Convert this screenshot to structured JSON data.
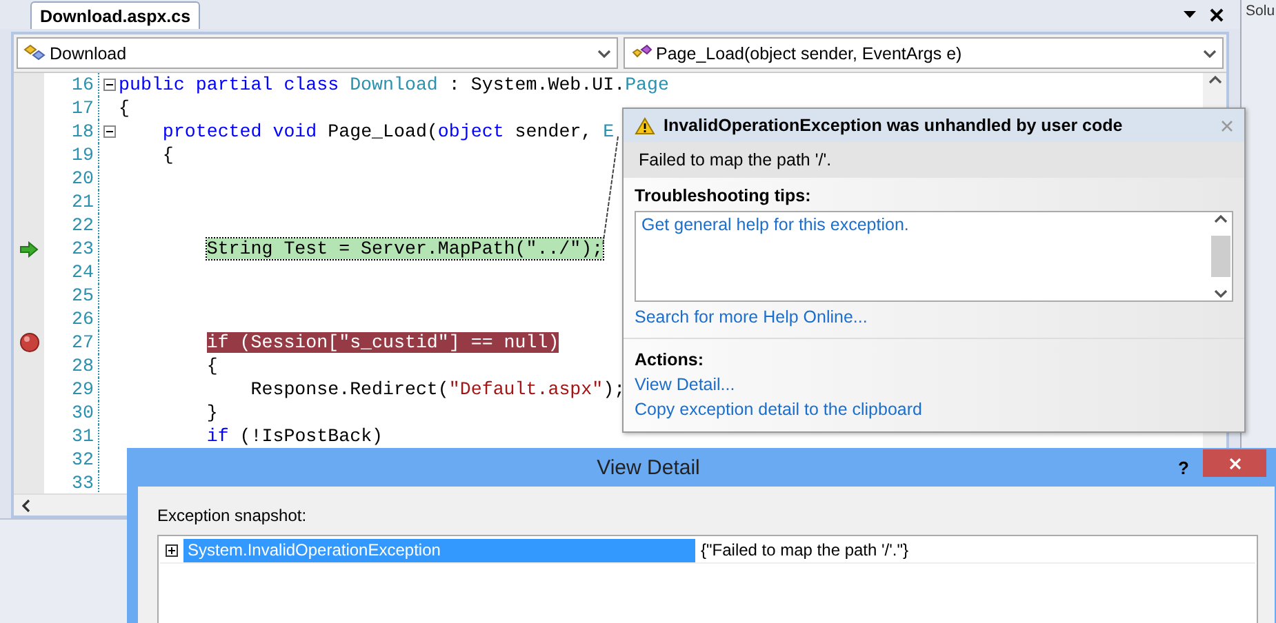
{
  "editor_tab": {
    "label": "Download.aspx.cs",
    "selected": true
  },
  "type_combo": {
    "value": "Download"
  },
  "member_combo": {
    "value": "Page_Load(object sender, EventArgs e)"
  },
  "code_lines": [
    {
      "number": "16",
      "collapsible": true,
      "current": false,
      "breakpoint": false,
      "segments": [
        {
          "text": "public partial class ",
          "kind": "keyword"
        },
        {
          "text": "Download",
          "kind": "type"
        },
        {
          "text": " : System.Web.UI.",
          "kind": "plain"
        },
        {
          "text": "Page",
          "kind": "type"
        }
      ]
    },
    {
      "number": "17",
      "collapsible": false,
      "current": false,
      "breakpoint": false,
      "segments": [
        {
          "text": "{",
          "kind": "plain"
        }
      ]
    },
    {
      "number": "18",
      "collapsible": true,
      "current": false,
      "breakpoint": false,
      "segments": [
        {
          "text": "    protected void ",
          "kind": "keyword"
        },
        {
          "text": "Page_Load(",
          "kind": "plain"
        },
        {
          "text": "object",
          "kind": "keyword"
        },
        {
          "text": " sender, ",
          "kind": "plain"
        },
        {
          "text": "E",
          "kind": "type"
        }
      ]
    },
    {
      "number": "19",
      "collapsible": false,
      "current": false,
      "breakpoint": false,
      "segments": [
        {
          "text": "    {",
          "kind": "plain"
        }
      ]
    },
    {
      "number": "20",
      "collapsible": false,
      "current": false,
      "breakpoint": false
    },
    {
      "number": "21",
      "collapsible": false,
      "current": false,
      "breakpoint": false
    },
    {
      "number": "22",
      "collapsible": false,
      "current": false,
      "breakpoint": false
    },
    {
      "number": "23",
      "collapsible": false,
      "current": true,
      "breakpoint": false,
      "segments": [
        {
          "text": "        String Test = Server.MapPath(\"../\");",
          "kind": "plain"
        }
      ]
    },
    {
      "number": "24",
      "collapsible": false,
      "current": false,
      "breakpoint": false
    },
    {
      "number": "25",
      "collapsible": false,
      "current": false,
      "breakpoint": false
    },
    {
      "number": "26",
      "collapsible": false,
      "current": false,
      "breakpoint": false
    },
    {
      "number": "27",
      "collapsible": false,
      "current": false,
      "breakpoint": true,
      "segments": [
        {
          "text": "        if (Session[\"s_custid\"] == null)",
          "kind": "plain"
        }
      ]
    },
    {
      "number": "28",
      "collapsible": false,
      "current": false,
      "breakpoint": false,
      "segments": [
        {
          "text": "        {",
          "kind": "plain"
        }
      ]
    },
    {
      "number": "29",
      "collapsible": false,
      "current": false,
      "breakpoint": false,
      "segments": [
        {
          "text": "            Response.Redirect(",
          "kind": "plain"
        },
        {
          "text": "\"Default.aspx\"",
          "kind": "string"
        },
        {
          "text": ");",
          "kind": "plain"
        }
      ]
    },
    {
      "number": "30",
      "collapsible": false,
      "current": false,
      "breakpoint": false,
      "segments": [
        {
          "text": "        }",
          "kind": "plain"
        }
      ]
    },
    {
      "number": "31",
      "collapsible": false,
      "current": false,
      "breakpoint": false,
      "segments": [
        {
          "text": "        if",
          "kind": "keyword"
        },
        {
          "text": " (!IsPostBack)",
          "kind": "plain"
        }
      ]
    },
    {
      "number": "32",
      "collapsible": false,
      "current": false,
      "breakpoint": false
    },
    {
      "number": "33",
      "collapsible": false,
      "current": false,
      "breakpoint": false
    }
  ],
  "solution_panel": {
    "title": "Solu"
  },
  "exception_popup": {
    "title": "InvalidOperationException was unhandled by user code",
    "message": "Failed to map the path '/'.",
    "tips_heading": "Troubleshooting tips:",
    "tips": [
      "Get general help for this exception."
    ],
    "search_link": "Search for more Help Online...",
    "actions_heading": "Actions:",
    "actions": [
      "View Detail...",
      "Copy exception detail to the clipboard"
    ]
  },
  "view_detail": {
    "title": "View Detail",
    "help": "?",
    "snapshot_label": "Exception snapshot:",
    "rows": [
      {
        "name": "System.InvalidOperationException",
        "value": "{\"Failed to map the path '/'.\"}",
        "selected": true,
        "expanded": false
      }
    ]
  }
}
